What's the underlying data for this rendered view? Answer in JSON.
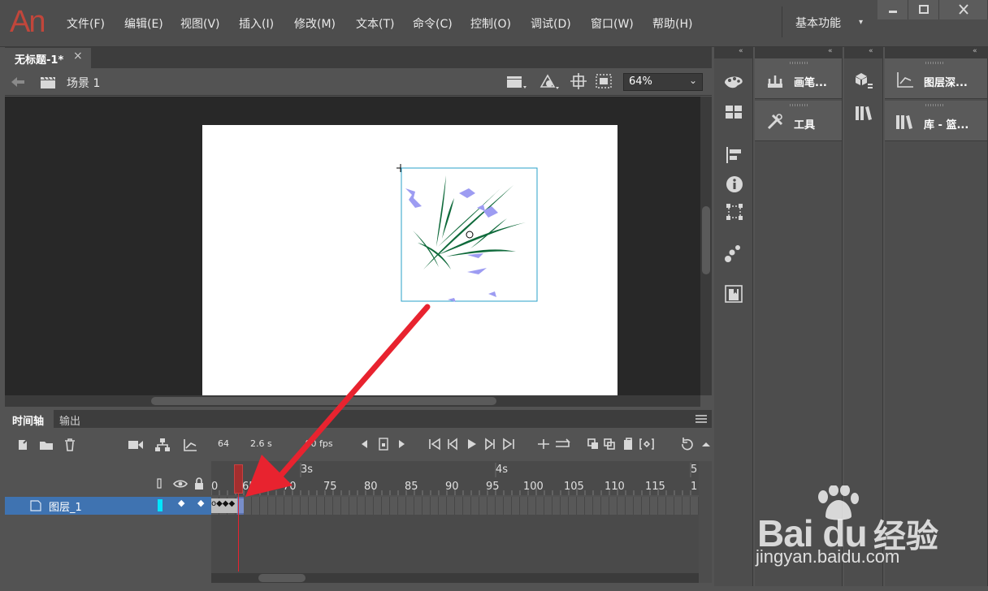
{
  "app": {
    "logo": "An",
    "menu": [
      "文件(F)",
      "编辑(E)",
      "视图(V)",
      "插入(I)",
      "修改(M)",
      "文本(T)",
      "命令(C)",
      "控制(O)",
      "调试(D)",
      "窗口(W)",
      "帮助(H)"
    ],
    "workspace": "基本功能"
  },
  "document": {
    "tab_label": "无标题-1*",
    "tab_close": "×",
    "scene_label": "场景 1",
    "zoom": "64%"
  },
  "timeline": {
    "tabs": {
      "timeline": "时间轴",
      "output": "输出"
    },
    "current_frame": "64",
    "elapsed": "2.6 s",
    "fps": "24.00 fps",
    "fps_visible": ".00 fps",
    "seconds_marks": [
      "3s",
      "4s",
      "5"
    ],
    "frame_labels": [
      "0",
      "65",
      "70",
      "75",
      "80",
      "85",
      "90",
      "95",
      "100",
      "105",
      "110",
      "115",
      "1"
    ],
    "layer_name": "图层_1",
    "keyframe_glyphs": "o◆◆◆"
  },
  "panels": {
    "col1": [
      "画笔...",
      "工具"
    ],
    "col2": [
      "图层深...",
      "库 - 篮..."
    ]
  },
  "colors": {
    "accent_red": "#e8232f",
    "layer_selected": "#3f73b1",
    "grass": "#0f6a3b",
    "flower": "#9d9cf2",
    "bbox": "#2aa0c8"
  },
  "watermark": {
    "brand": "Bai  du",
    "brand_cn": "经验",
    "url": "jingyan.baidu.com"
  }
}
